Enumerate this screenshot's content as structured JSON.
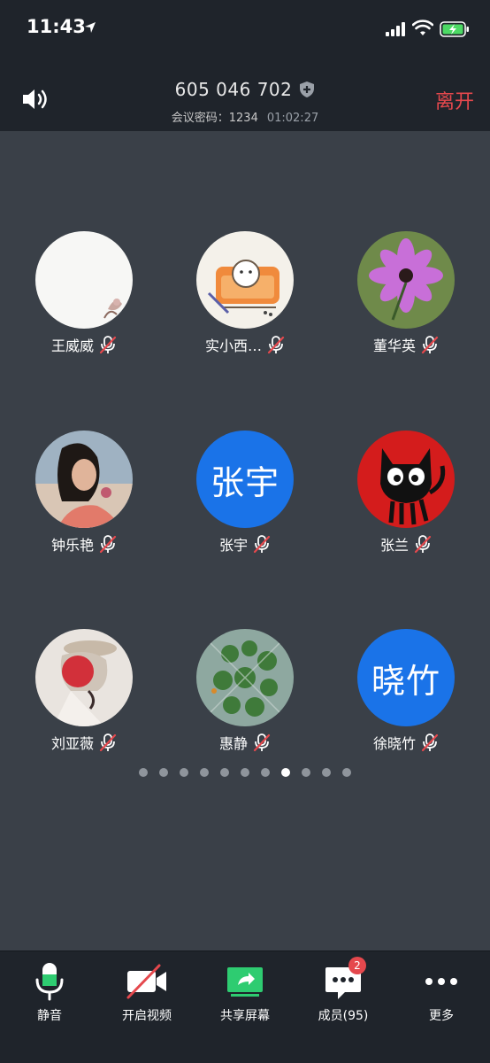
{
  "status_bar": {
    "time": "11:43"
  },
  "header": {
    "meeting_id": "605 046 702",
    "password_label": "会议密码：1234",
    "elapsed": "01:02:27",
    "leave_label": "离开"
  },
  "participants": [
    {
      "name": "王威威",
      "muted": true
    },
    {
      "name": "实小西…",
      "muted": true
    },
    {
      "name": "董华英",
      "muted": true
    },
    {
      "name": "钟乐艳",
      "muted": true
    },
    {
      "name": "张宇",
      "muted": true,
      "avatar_text": "张宇"
    },
    {
      "name": "张兰",
      "muted": true
    },
    {
      "name": "刘亚薇",
      "muted": true
    },
    {
      "name": "惠静",
      "muted": true
    },
    {
      "name": "徐晓竹",
      "muted": true,
      "avatar_text": "晓竹"
    }
  ],
  "pager": {
    "total": 11,
    "active_index": 7
  },
  "toolbar": {
    "mute_label": "静音",
    "video_label": "开启视频",
    "share_label": "共享屏幕",
    "members_label": "成员(95)",
    "members_badge": "2",
    "more_label": "更多"
  },
  "colors": {
    "background": "#3a4048",
    "bar": "#1f242b",
    "accent_red": "#e5484d",
    "accent_green": "#2ecc71",
    "avatar_blue": "#1a73e8"
  }
}
